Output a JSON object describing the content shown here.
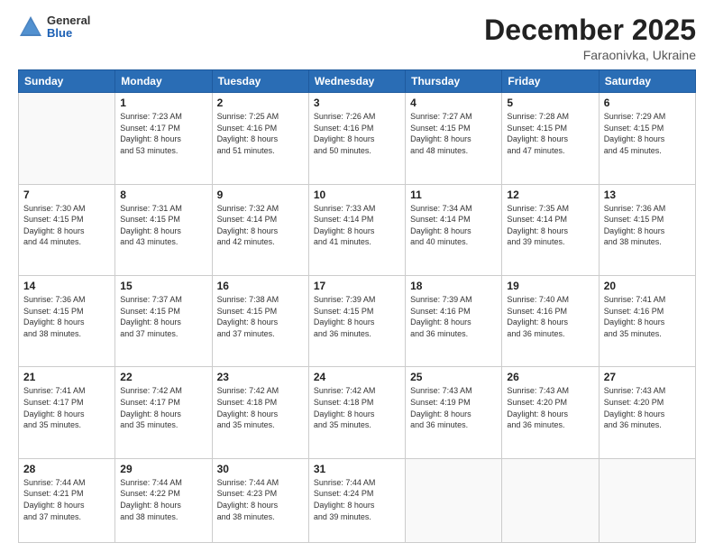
{
  "header": {
    "logo": {
      "general": "General",
      "blue": "Blue"
    },
    "title": "December 2025",
    "subtitle": "Faraonivka, Ukraine"
  },
  "days_of_week": [
    "Sunday",
    "Monday",
    "Tuesday",
    "Wednesday",
    "Thursday",
    "Friday",
    "Saturday"
  ],
  "weeks": [
    [
      {
        "day": "",
        "info": ""
      },
      {
        "day": "1",
        "info": "Sunrise: 7:23 AM\nSunset: 4:17 PM\nDaylight: 8 hours\nand 53 minutes."
      },
      {
        "day": "2",
        "info": "Sunrise: 7:25 AM\nSunset: 4:16 PM\nDaylight: 8 hours\nand 51 minutes."
      },
      {
        "day": "3",
        "info": "Sunrise: 7:26 AM\nSunset: 4:16 PM\nDaylight: 8 hours\nand 50 minutes."
      },
      {
        "day": "4",
        "info": "Sunrise: 7:27 AM\nSunset: 4:15 PM\nDaylight: 8 hours\nand 48 minutes."
      },
      {
        "day": "5",
        "info": "Sunrise: 7:28 AM\nSunset: 4:15 PM\nDaylight: 8 hours\nand 47 minutes."
      },
      {
        "day": "6",
        "info": "Sunrise: 7:29 AM\nSunset: 4:15 PM\nDaylight: 8 hours\nand 45 minutes."
      }
    ],
    [
      {
        "day": "7",
        "info": "Sunrise: 7:30 AM\nSunset: 4:15 PM\nDaylight: 8 hours\nand 44 minutes."
      },
      {
        "day": "8",
        "info": "Sunrise: 7:31 AM\nSunset: 4:15 PM\nDaylight: 8 hours\nand 43 minutes."
      },
      {
        "day": "9",
        "info": "Sunrise: 7:32 AM\nSunset: 4:14 PM\nDaylight: 8 hours\nand 42 minutes."
      },
      {
        "day": "10",
        "info": "Sunrise: 7:33 AM\nSunset: 4:14 PM\nDaylight: 8 hours\nand 41 minutes."
      },
      {
        "day": "11",
        "info": "Sunrise: 7:34 AM\nSunset: 4:14 PM\nDaylight: 8 hours\nand 40 minutes."
      },
      {
        "day": "12",
        "info": "Sunrise: 7:35 AM\nSunset: 4:14 PM\nDaylight: 8 hours\nand 39 minutes."
      },
      {
        "day": "13",
        "info": "Sunrise: 7:36 AM\nSunset: 4:15 PM\nDaylight: 8 hours\nand 38 minutes."
      }
    ],
    [
      {
        "day": "14",
        "info": "Sunrise: 7:36 AM\nSunset: 4:15 PM\nDaylight: 8 hours\nand 38 minutes."
      },
      {
        "day": "15",
        "info": "Sunrise: 7:37 AM\nSunset: 4:15 PM\nDaylight: 8 hours\nand 37 minutes."
      },
      {
        "day": "16",
        "info": "Sunrise: 7:38 AM\nSunset: 4:15 PM\nDaylight: 8 hours\nand 37 minutes."
      },
      {
        "day": "17",
        "info": "Sunrise: 7:39 AM\nSunset: 4:15 PM\nDaylight: 8 hours\nand 36 minutes."
      },
      {
        "day": "18",
        "info": "Sunrise: 7:39 AM\nSunset: 4:16 PM\nDaylight: 8 hours\nand 36 minutes."
      },
      {
        "day": "19",
        "info": "Sunrise: 7:40 AM\nSunset: 4:16 PM\nDaylight: 8 hours\nand 36 minutes."
      },
      {
        "day": "20",
        "info": "Sunrise: 7:41 AM\nSunset: 4:16 PM\nDaylight: 8 hours\nand 35 minutes."
      }
    ],
    [
      {
        "day": "21",
        "info": "Sunrise: 7:41 AM\nSunset: 4:17 PM\nDaylight: 8 hours\nand 35 minutes."
      },
      {
        "day": "22",
        "info": "Sunrise: 7:42 AM\nSunset: 4:17 PM\nDaylight: 8 hours\nand 35 minutes."
      },
      {
        "day": "23",
        "info": "Sunrise: 7:42 AM\nSunset: 4:18 PM\nDaylight: 8 hours\nand 35 minutes."
      },
      {
        "day": "24",
        "info": "Sunrise: 7:42 AM\nSunset: 4:18 PM\nDaylight: 8 hours\nand 35 minutes."
      },
      {
        "day": "25",
        "info": "Sunrise: 7:43 AM\nSunset: 4:19 PM\nDaylight: 8 hours\nand 36 minutes."
      },
      {
        "day": "26",
        "info": "Sunrise: 7:43 AM\nSunset: 4:20 PM\nDaylight: 8 hours\nand 36 minutes."
      },
      {
        "day": "27",
        "info": "Sunrise: 7:43 AM\nSunset: 4:20 PM\nDaylight: 8 hours\nand 36 minutes."
      }
    ],
    [
      {
        "day": "28",
        "info": "Sunrise: 7:44 AM\nSunset: 4:21 PM\nDaylight: 8 hours\nand 37 minutes."
      },
      {
        "day": "29",
        "info": "Sunrise: 7:44 AM\nSunset: 4:22 PM\nDaylight: 8 hours\nand 38 minutes."
      },
      {
        "day": "30",
        "info": "Sunrise: 7:44 AM\nSunset: 4:23 PM\nDaylight: 8 hours\nand 38 minutes."
      },
      {
        "day": "31",
        "info": "Sunrise: 7:44 AM\nSunset: 4:24 PM\nDaylight: 8 hours\nand 39 minutes."
      },
      {
        "day": "",
        "info": ""
      },
      {
        "day": "",
        "info": ""
      },
      {
        "day": "",
        "info": ""
      }
    ]
  ]
}
